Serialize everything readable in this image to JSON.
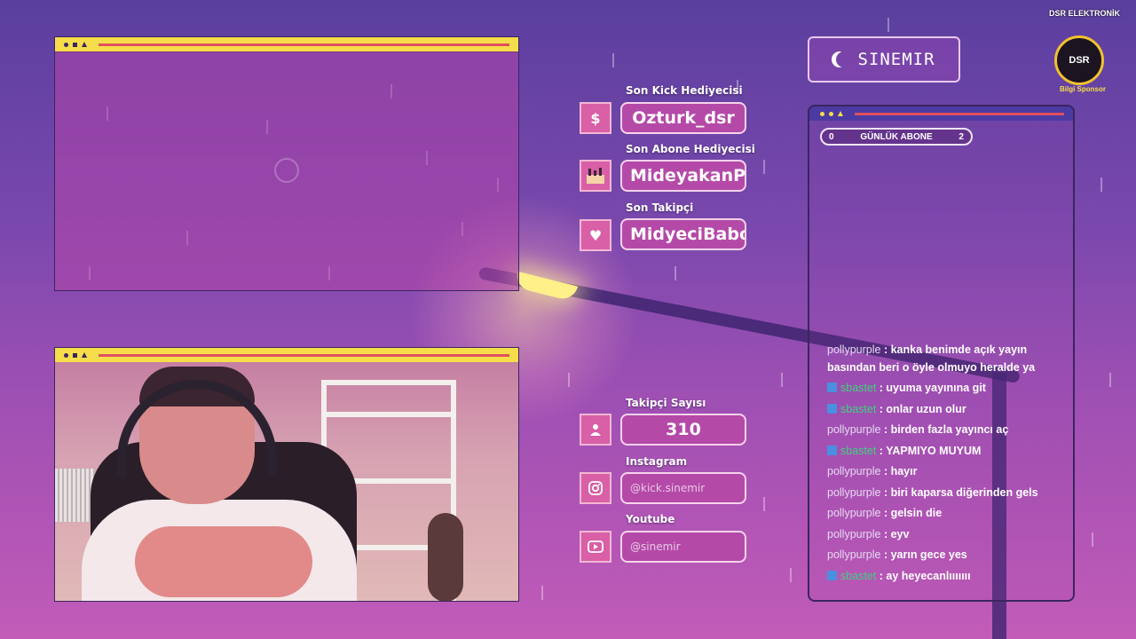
{
  "sponsor": {
    "title": "DSR ELEKTRONİK",
    "circle_text": "DSR",
    "subtitle": "Bilgi Sponsor"
  },
  "header": {
    "streamer_name": "SINEMIR"
  },
  "stats": {
    "last_kick_gift": {
      "label": "Son Kick Hediyecisi",
      "icon": "$",
      "value": "Ozturk_dsr"
    },
    "last_sub_gift": {
      "label": "Son Abone Hediyecisi",
      "value": "MideyakanPog"
    },
    "last_follower": {
      "label": "Son Takipçi",
      "icon": "♥",
      "value": "MidyeciBabo"
    },
    "follower_count": {
      "label": "Takipçi Sayısı",
      "value": "310"
    },
    "instagram": {
      "label": "Instagram",
      "value": "@kick.sinemir"
    },
    "youtube": {
      "label": "Youtube",
      "value": "@sinemir"
    }
  },
  "chat": {
    "daily_sub": {
      "start": "0",
      "label": "GÜNLÜK ABONE",
      "goal": "2"
    },
    "messages": [
      {
        "user": "pollypurple",
        "text": "kanka benimde açık yayın basından beri o öyle olmuyo heralde ya",
        "badge": false
      },
      {
        "user": "sbastet",
        "text": "uyuma yayınına git",
        "badge": true
      },
      {
        "user": "sbastet",
        "text": "onlar uzun olur",
        "badge": true
      },
      {
        "user": "pollypurple",
        "text": "birden fazla yayıncı aç",
        "badge": false
      },
      {
        "user": "sbastet",
        "text": "YAPMIYO MUYUM",
        "badge": true
      },
      {
        "user": "pollypurple",
        "text": "hayır",
        "badge": false
      },
      {
        "user": "pollypurple",
        "text": "biri kaparsa diğerinden gels",
        "badge": false
      },
      {
        "user": "pollypurple",
        "text": "gelsin die",
        "badge": false
      },
      {
        "user": "pollypurple",
        "text": "eyv",
        "badge": false
      },
      {
        "user": "pollypurple",
        "text": "yarın gece yes",
        "badge": false
      },
      {
        "user": "sbastet",
        "text": "ay heyecanlııııııı",
        "badge": true
      }
    ]
  }
}
